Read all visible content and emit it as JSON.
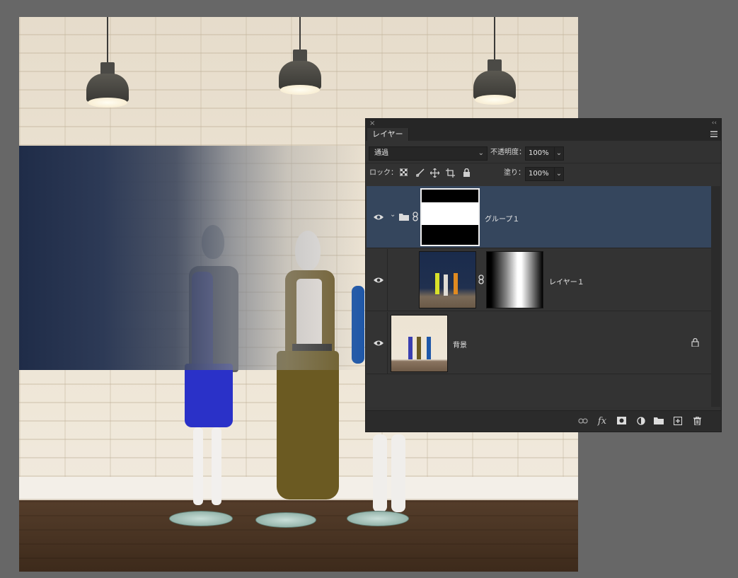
{
  "panel": {
    "tab_label": "レイヤー",
    "close_glyph": "×",
    "collapse_glyph": "‹‹",
    "blend_mode": "通過",
    "opacity_label": "不透明度：",
    "opacity_value": "100%",
    "lock_label": "ロック：",
    "fill_label": "塗り：",
    "fill_value": "100%"
  },
  "layers": [
    {
      "name": "グループ１",
      "type": "group",
      "visible": true,
      "selected": true,
      "has_mask": true
    },
    {
      "name": "レイヤー１",
      "type": "pixel",
      "visible": true,
      "selected": false,
      "has_mask": true
    },
    {
      "name": "背景",
      "type": "background",
      "visible": true,
      "selected": false,
      "locked": true
    }
  ],
  "icons": {
    "lock_transparent": "checker-icon",
    "lock_paint": "brush-icon",
    "lock_position": "move-icon",
    "lock_artboard": "artboard-icon",
    "lock_all": "lock-icon",
    "bottom": [
      "link-icon",
      "fx-icon",
      "mask-icon",
      "adjustment-icon",
      "folder-icon",
      "new-layer-icon",
      "trash-icon"
    ]
  },
  "bottom_fx_label": "fx",
  "colors": {
    "panel_bg": "#323232",
    "selected_layer": "#35465d",
    "workspace_bg": "#676767"
  }
}
